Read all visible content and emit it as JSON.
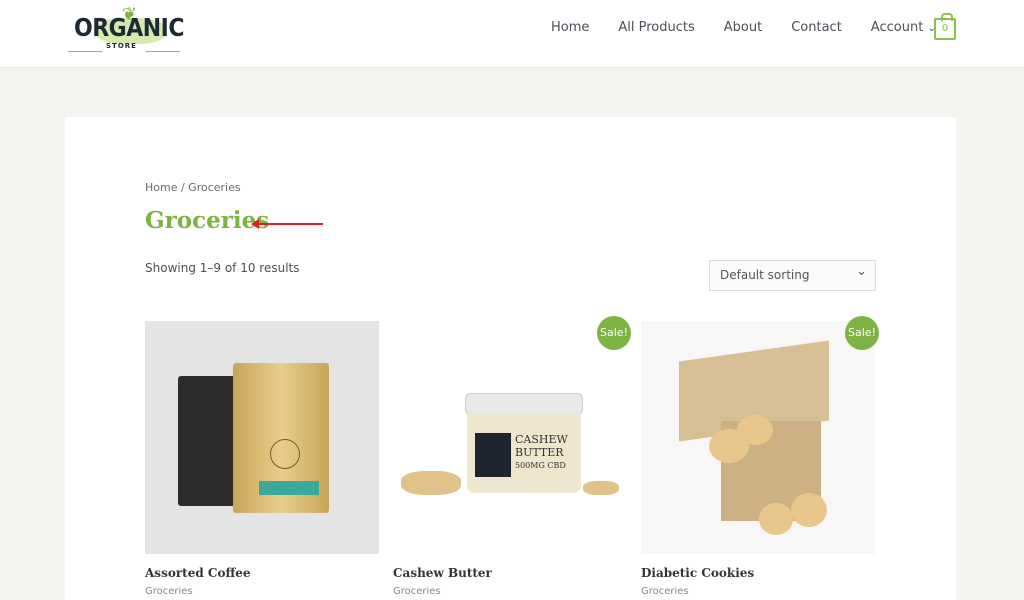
{
  "logo": {
    "text": "ORGANIC",
    "sub": "STORE"
  },
  "nav": {
    "items": [
      "Home",
      "All Products",
      "About",
      "Contact",
      "Account"
    ],
    "cart_count": "0"
  },
  "breadcrumb": "Home / Groceries",
  "title": "Groceries",
  "result_count": "Showing 1–9 of 10 results",
  "sort": {
    "selected": "Default sorting"
  },
  "colors": {
    "accent": "#7cb342",
    "annotation_arrow": "#e02020"
  },
  "products": [
    {
      "name": "Assorted Coffee",
      "category": "Groceries",
      "sale": ""
    },
    {
      "name": "Cashew Butter",
      "category": "Groceries",
      "sale": "Sale!",
      "label_lines": [
        "CASHEW",
        "BUTTER",
        "500MG CBD"
      ]
    },
    {
      "name": "Diabetic Cookies",
      "category": "Groceries",
      "sale": "Sale!"
    }
  ]
}
